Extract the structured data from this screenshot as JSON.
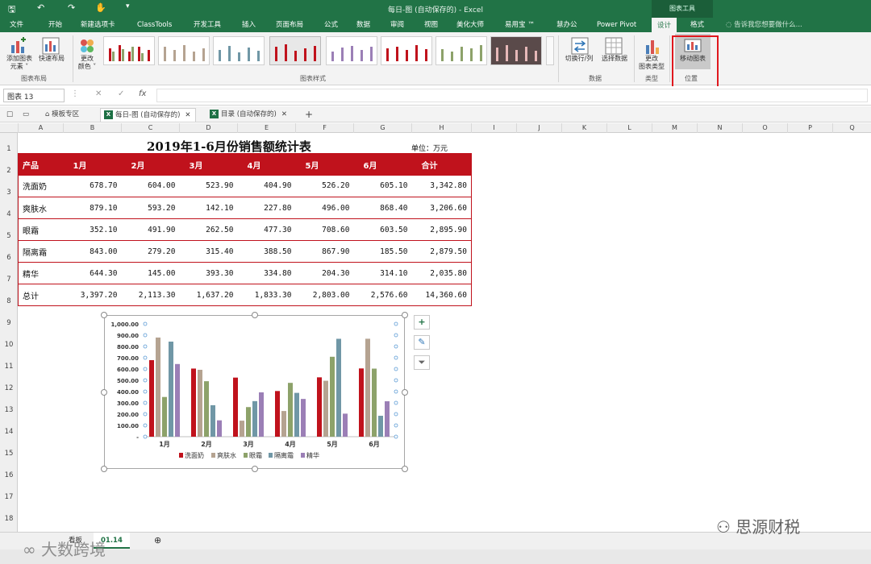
{
  "window": {
    "title": "每日-图 (自动保存的) - Excel",
    "context_tools": "图表工具"
  },
  "ribbon_tabs": [
    {
      "label": "文件"
    },
    {
      "label": "开始"
    },
    {
      "label": "新建选项卡"
    },
    {
      "label": "ClassTools"
    },
    {
      "label": "开发工具"
    },
    {
      "label": "插入"
    },
    {
      "label": "页面布局"
    },
    {
      "label": "公式"
    },
    {
      "label": "数据"
    },
    {
      "label": "审阅"
    },
    {
      "label": "视图"
    },
    {
      "label": "美化大师"
    },
    {
      "label": "易用宝 ™"
    },
    {
      "label": "慧办公"
    },
    {
      "label": "Power Pivot"
    },
    {
      "label": "设计"
    },
    {
      "label": "格式"
    }
  ],
  "tell_me": "告诉我您想要做什么...",
  "ribbon": {
    "add_element": "添加图表\n元素 ˅",
    "quick_layout": "快速布局",
    "group_layout": "图表布局",
    "change_colors": "更改\n颜色 ˅",
    "group_styles": "图表样式",
    "switch_row_col": "切换行/列",
    "select_data": "选择数据",
    "group_data": "数据",
    "change_type": "更改\n图表类型",
    "group_type": "类型",
    "move_chart": "移动图表",
    "group_location": "位置"
  },
  "formula_bar": {
    "name_box": "图表 13",
    "cancel": "✕",
    "enter": "✓",
    "fx": "fx"
  },
  "doc_tabs": [
    {
      "label": "模板专区"
    },
    {
      "label": "每日-图 (自动保存的)"
    },
    {
      "label": "目录 (自动保存的)"
    }
  ],
  "columns": [
    "A",
    "B",
    "C",
    "D",
    "E",
    "F",
    "G",
    "H",
    "I",
    "J",
    "K",
    "L",
    "M",
    "N",
    "O",
    "P",
    "Q",
    "R"
  ],
  "rows": [
    "1",
    "2",
    "3",
    "4",
    "5",
    "6",
    "7",
    "8",
    "9",
    "10",
    "11",
    "12",
    "13",
    "14",
    "15",
    "16",
    "17",
    "18"
  ],
  "sheet": {
    "title": "2019年1-6月份销售额统计表",
    "unit": "单位：万元",
    "headers": [
      "产品",
      "1月",
      "2月",
      "3月",
      "4月",
      "5月",
      "6月",
      "合计"
    ],
    "rows": [
      [
        "洗面奶",
        "678.70",
        "604.00",
        "523.90",
        "404.90",
        "526.20",
        "605.10",
        "3,342.80"
      ],
      [
        "爽肤水",
        "879.10",
        "593.20",
        "142.10",
        "227.80",
        "496.00",
        "868.40",
        "3,206.60"
      ],
      [
        "眼霜",
        "352.10",
        "491.90",
        "262.50",
        "477.30",
        "708.60",
        "603.50",
        "2,895.90"
      ],
      [
        "隔离霜",
        "843.00",
        "279.20",
        "315.40",
        "388.50",
        "867.90",
        "185.50",
        "2,879.50"
      ],
      [
        "精华",
        "644.30",
        "145.00",
        "393.30",
        "334.80",
        "204.30",
        "314.10",
        "2,035.80"
      ],
      [
        "总计",
        "3,397.20",
        "2,113.30",
        "1,637.20",
        "1,833.30",
        "2,803.00",
        "2,576.60",
        "14,360.60"
      ]
    ]
  },
  "chart_data": {
    "type": "bar",
    "categories": [
      "1月",
      "2月",
      "3月",
      "4月",
      "5月",
      "6月"
    ],
    "series": [
      {
        "name": "洗面奶",
        "values": [
          678.7,
          604.0,
          523.9,
          404.9,
          526.2,
          605.1
        ]
      },
      {
        "name": "爽肤水",
        "values": [
          879.1,
          593.2,
          142.1,
          227.8,
          496.0,
          868.4
        ]
      },
      {
        "name": "眼霜",
        "values": [
          352.1,
          491.9,
          262.5,
          477.3,
          708.6,
          603.5
        ]
      },
      {
        "name": "隔离霜",
        "values": [
          843.0,
          279.2,
          315.4,
          388.5,
          867.9,
          185.5
        ]
      },
      {
        "name": "精华",
        "values": [
          644.3,
          145.0,
          393.3,
          334.8,
          204.3,
          314.1
        ]
      }
    ],
    "colors": [
      "#c0121c",
      "#b5a391",
      "#8da26a",
      "#7097a6",
      "#9b7fb6"
    ],
    "yticks": [
      "-",
      "100.00",
      "200.00",
      "300.00",
      "400.00",
      "500.00",
      "600.00",
      "700.00",
      "800.00",
      "900.00",
      "1,000.00"
    ],
    "ylim": [
      0,
      1000
    ],
    "legend_position": "bottom",
    "grid": false
  },
  "sheet_tabs": [
    {
      "label": "看板"
    },
    {
      "label": "01.14"
    }
  ],
  "watermarks": {
    "left": "大数跨境",
    "right": "思源财税"
  },
  "accent": "#217346",
  "table_red": "#c0121c"
}
